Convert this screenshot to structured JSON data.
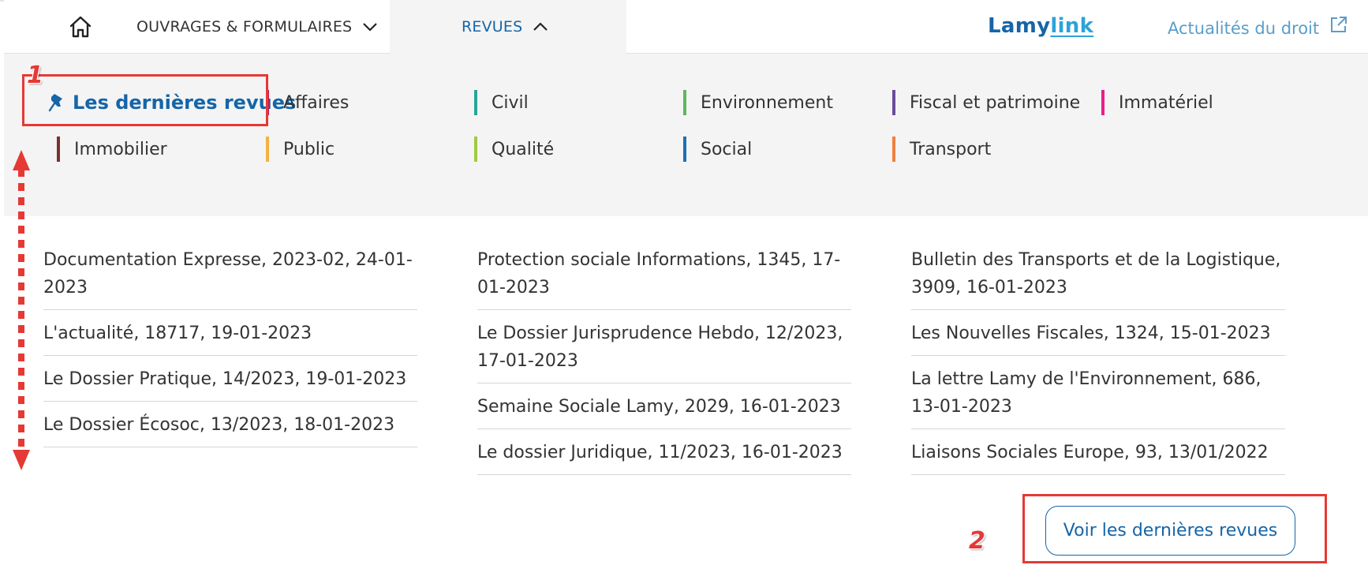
{
  "topnav": {
    "home_icon": "home-icon",
    "ouvrages_label": "OUVRAGES & FORMULAIRES",
    "revues_label": "REVUES",
    "brand_left": "Lamy",
    "brand_right": "link",
    "actualites_label": "Actualités du droit"
  },
  "categories": {
    "pinned_label": "Les dernières revues",
    "items": [
      {
        "label": "Affaires",
        "color": "#c2185b"
      },
      {
        "label": "Civil",
        "color": "#26a69a"
      },
      {
        "label": "Environnement",
        "color": "#5cb85c"
      },
      {
        "label": "Fiscal et patrimoine",
        "color": "#6a4c9c"
      },
      {
        "label": "Immatériel",
        "color": "#e91e8c"
      },
      {
        "label": "Immobilier",
        "color": "#7b2f2f"
      },
      {
        "label": "Public",
        "color": "#f5b041"
      },
      {
        "label": "Qualité",
        "color": "#9ccc3d"
      },
      {
        "label": "Social",
        "color": "#1e6fb5"
      },
      {
        "label": "Transport",
        "color": "#f08040"
      }
    ]
  },
  "columns": [
    [
      "Documentation Expresse, 2023-02, 24-01-2023",
      "L'actualité, 18717, 19-01-2023",
      "Le Dossier Pratique, 14/2023, 19-01-2023",
      "Le Dossier Écosoc, 13/2023, 18-01-2023"
    ],
    [
      "Protection sociale Informations, 1345, 17-01-2023",
      "Le Dossier Jurisprudence Hebdo, 12/2023, 17-01-2023",
      "Semaine Sociale Lamy, 2029, 16-01-2023",
      "Le dossier Juridique, 11/2023, 16-01-2023"
    ],
    [
      "Bulletin des Transports et de la Logistique, 3909, 16-01-2023",
      "Les Nouvelles Fiscales, 1324, 15-01-2023",
      "La lettre Lamy de l'Environnement, 686, 13-01-2023",
      "Liaisons Sociales Europe, 93, 13/01/2022"
    ]
  ],
  "button": {
    "label": "Voir les dernières revues"
  },
  "annotations": {
    "one": "1",
    "two": "2"
  },
  "colors": {
    "brand": "#1565a8",
    "brand_accent": "#2da3d8",
    "callout": "#e53935",
    "panel_bg": "#f4f4f4"
  }
}
